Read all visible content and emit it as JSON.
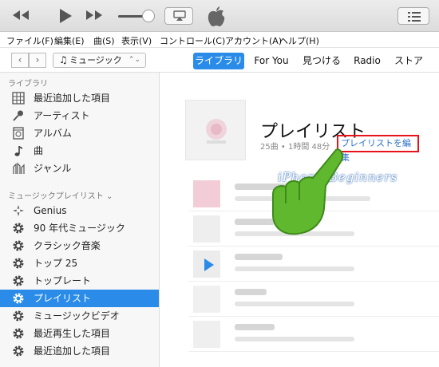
{
  "toolbar": {
    "rewind_icon": "rewind-icon",
    "play_icon": "play-icon",
    "forward_icon": "fast-forward-icon",
    "volume_level": 0.8,
    "airplay_icon": "airplay-icon",
    "apple_icon": "apple-logo",
    "list_icon": "list-icon"
  },
  "menubar": [
    "ファイル(F)",
    "編集(E)",
    "曲(S)",
    "表示(V)",
    "コントロール(C)",
    "アカウント(A)",
    "ヘルプ(H)"
  ],
  "navbar": {
    "back": "‹",
    "forward": "›",
    "media_selector": "ミュージック",
    "tabs": [
      {
        "label": "ライブラリ",
        "active": true
      },
      {
        "label": "For You",
        "active": false
      },
      {
        "label": "見つける",
        "active": false
      },
      {
        "label": "Radio",
        "active": false
      },
      {
        "label": "ストア",
        "active": false
      }
    ]
  },
  "sidebar": {
    "library_header": "ライブラリ",
    "library": [
      {
        "label": "最近追加した項目",
        "icon": "recent-grid-icon"
      },
      {
        "label": "アーティスト",
        "icon": "microphone-icon"
      },
      {
        "label": "アルバム",
        "icon": "album-icon"
      },
      {
        "label": "曲",
        "icon": "music-note-icon"
      },
      {
        "label": "ジャンル",
        "icon": "genre-icon"
      }
    ],
    "playlists_header": "ミュージックプレイリスト",
    "playlists": [
      {
        "label": "Genius",
        "icon": "genius-icon"
      },
      {
        "label": "90 年代ミュージック",
        "icon": "gear-icon"
      },
      {
        "label": "クラシック音楽",
        "icon": "gear-icon"
      },
      {
        "label": "トップ 25",
        "icon": "gear-icon"
      },
      {
        "label": "トップレート",
        "icon": "gear-icon"
      },
      {
        "label": "プレイリスト",
        "icon": "gear-icon",
        "selected": true
      },
      {
        "label": "ミュージックビデオ",
        "icon": "gear-icon"
      },
      {
        "label": "最近再生した項目",
        "icon": "gear-icon"
      },
      {
        "label": "最近追加した項目",
        "icon": "gear-icon"
      }
    ]
  },
  "main": {
    "title": "プレイリスト",
    "meta": "25曲 • 1時間 48分",
    "edit_link": "プレイリストを編集",
    "watermark": "iPhone Beginners"
  },
  "colors": {
    "accent": "#2a8ce8",
    "highlight_box": "#e8141b",
    "hand_green": "#5fb82e"
  }
}
